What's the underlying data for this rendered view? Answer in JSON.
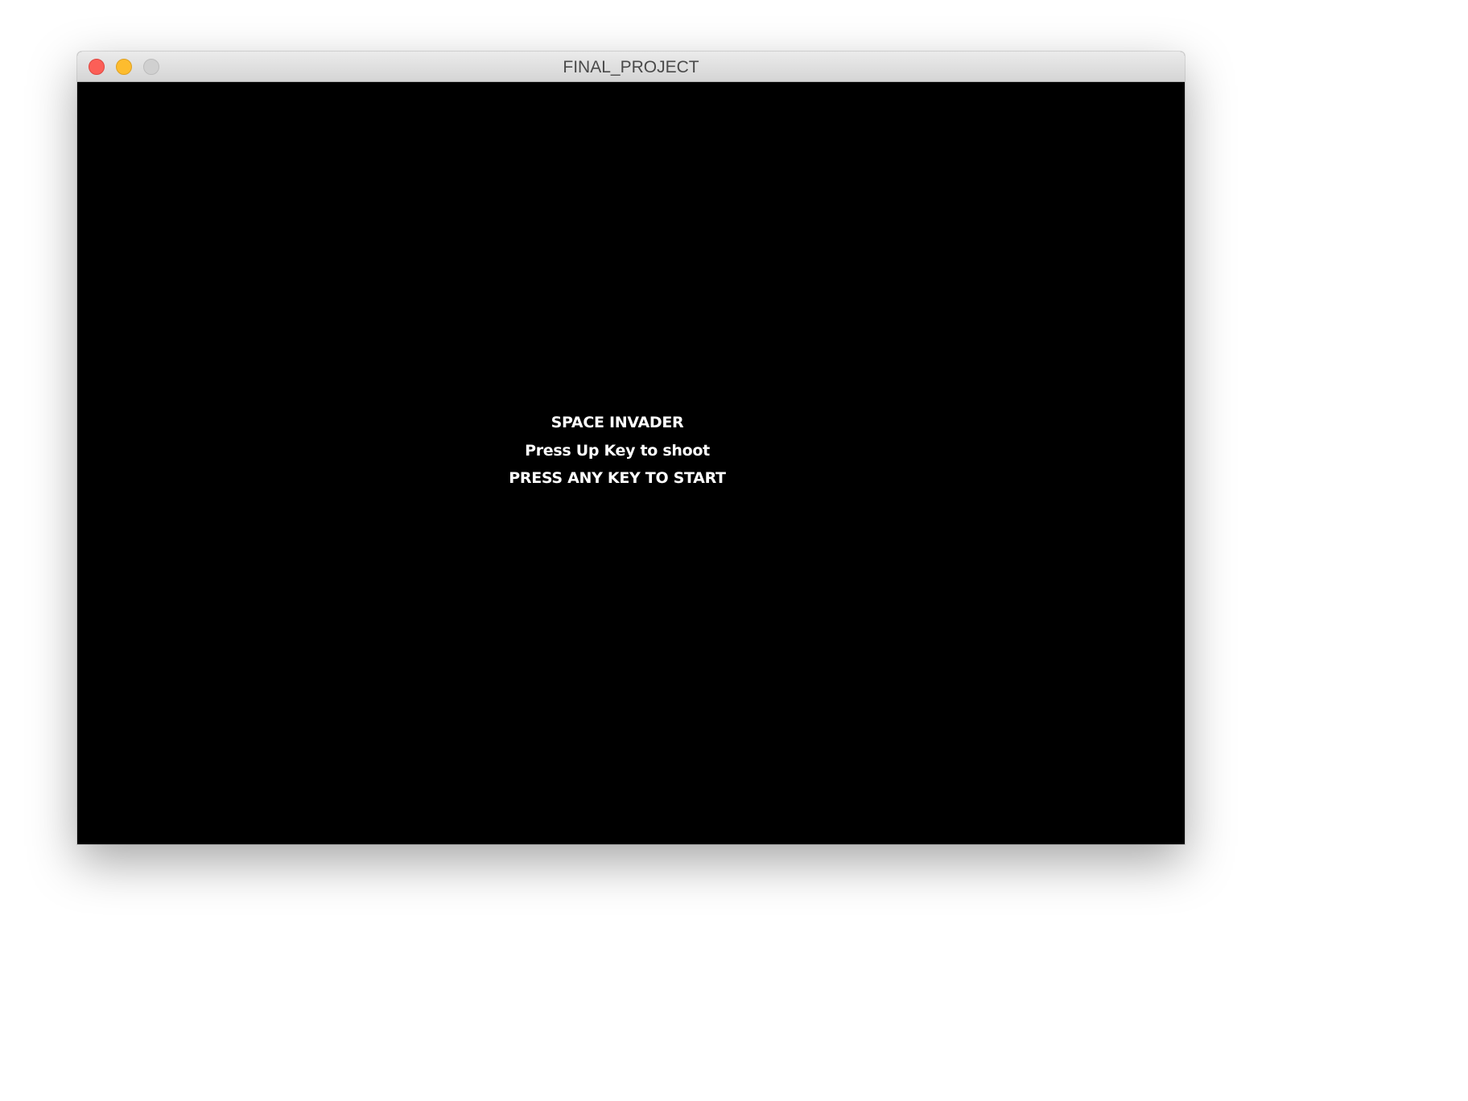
{
  "window": {
    "title": "FINAL_PROJECT"
  },
  "controls": {
    "close_icon": "close-icon",
    "minimize_icon": "minimize-icon",
    "zoom_icon": "zoom-icon",
    "colors": {
      "close": "#fc5f57",
      "minimize": "#fdbc2e",
      "zoom": "#d0d0d0"
    }
  },
  "game": {
    "background_color": "#000000",
    "text_color": "#ffffff",
    "title": "SPACE INVADER",
    "instructions": "Press Up Key to shoot",
    "start_prompt": "PRESS ANY KEY TO START"
  }
}
